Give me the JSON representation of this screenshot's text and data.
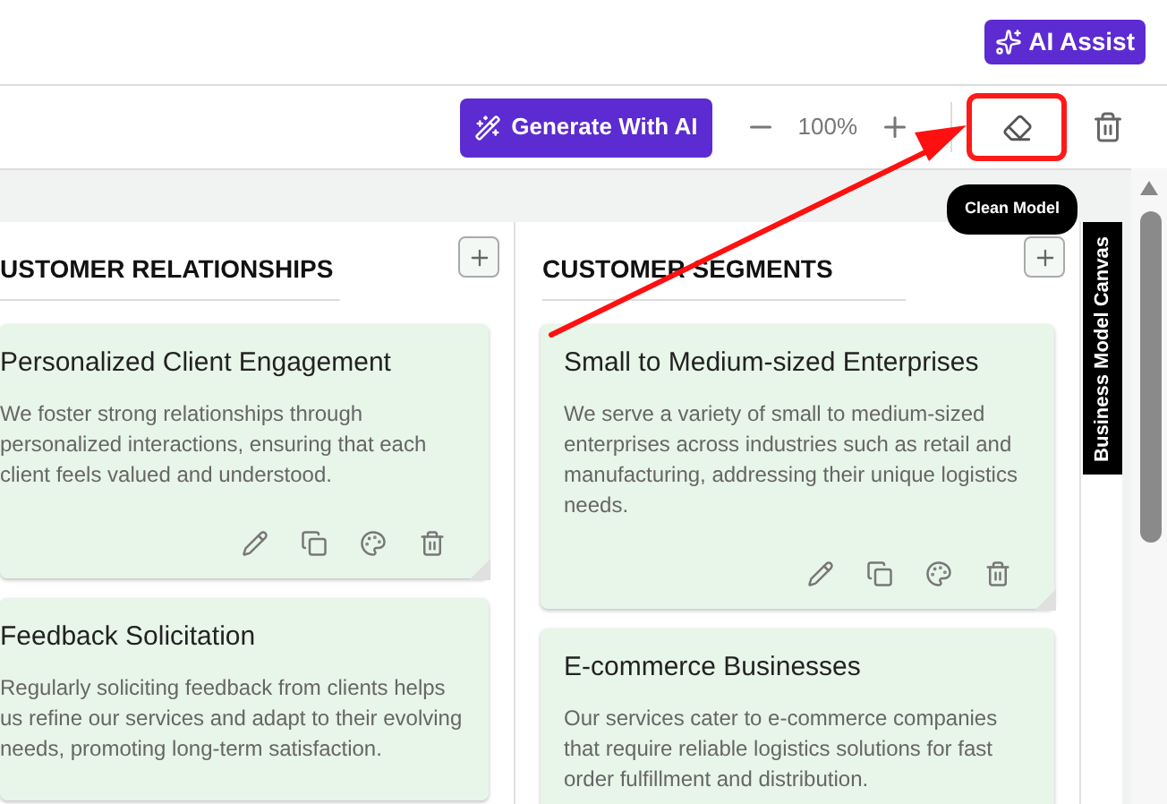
{
  "header": {
    "assist_button": "AI Assist"
  },
  "toolbar": {
    "generate_button": "Generate With AI",
    "zoom": "100%"
  },
  "tooltip": "Clean Model",
  "side_tab": "Business Model Canvas",
  "columns": [
    {
      "title": "USTOMER RELATIONSHIPS",
      "cards": [
        {
          "title": "Personalized Client Engagement",
          "description": "We foster strong relationships through personalized interactions, ensuring that each client feels valued and understood.",
          "actions": true
        },
        {
          "title": "Feedback Solicitation",
          "description": "Regularly soliciting feedback from clients helps us refine our services and adapt to their evolving needs, promoting long-term satisfaction.",
          "actions": false
        }
      ]
    },
    {
      "title": "CUSTOMER SEGMENTS",
      "cards": [
        {
          "title": "Small to Medium-sized Enterprises",
          "description": "We serve a variety of small to medium-sized enterprises across industries such as retail and manufacturing, addressing their unique logistics needs.",
          "actions": true
        },
        {
          "title": "E-commerce Businesses",
          "description": "Our services cater to e-commerce companies that require reliable logistics solutions for fast order fulfillment and distribution.",
          "actions": false
        }
      ]
    }
  ]
}
